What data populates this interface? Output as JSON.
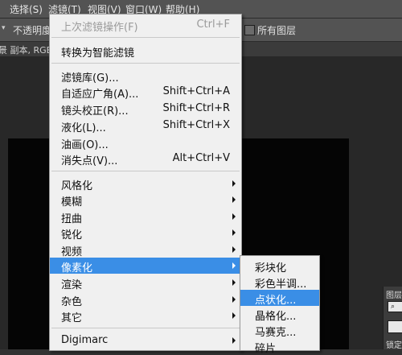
{
  "menubar": {
    "items": [
      {
        "label": "选择(S)"
      },
      {
        "label": "滤镜(T)"
      },
      {
        "label": "视图(V)"
      },
      {
        "label": "窗口(W)"
      },
      {
        "label": "帮助(H)"
      }
    ]
  },
  "options": {
    "opacity_label": "不透明度",
    "all_layers_label": "所有图层"
  },
  "doc_tab": {
    "title": "景 副本, RGB"
  },
  "filter_menu": {
    "last_filter": {
      "label": "上次滤镜操作(F)",
      "shortcut": "Ctrl+F"
    },
    "convert_smart": {
      "label": "转换为智能滤镜"
    },
    "gallery": {
      "label": "滤镜库(G)..."
    },
    "adaptive_wide": {
      "label": "自适应广角(A)...",
      "shortcut": "Shift+Ctrl+A"
    },
    "lens_correction": {
      "label": "镜头校正(R)...",
      "shortcut": "Shift+Ctrl+R"
    },
    "liquify": {
      "label": "液化(L)...",
      "shortcut": "Shift+Ctrl+X"
    },
    "oil_paint": {
      "label": "油画(O)..."
    },
    "vanishing_point": {
      "label": "消失点(V)...",
      "shortcut": "Alt+Ctrl+V"
    },
    "stylize": {
      "label": "风格化"
    },
    "blur": {
      "label": "模糊"
    },
    "distort": {
      "label": "扭曲"
    },
    "sharpen": {
      "label": "锐化"
    },
    "video": {
      "label": "视频"
    },
    "pixelate": {
      "label": "像素化"
    },
    "render": {
      "label": "渲染"
    },
    "noise": {
      "label": "杂色"
    },
    "other": {
      "label": "其它"
    },
    "digimarc": {
      "label": "Digimarc"
    }
  },
  "pixelate_submenu": {
    "items": [
      {
        "label": "彩块化"
      },
      {
        "label": "彩色半调..."
      },
      {
        "label": "点状化..."
      },
      {
        "label": "晶格化..."
      },
      {
        "label": "马赛克..."
      },
      {
        "label": "碎片"
      }
    ],
    "highlighted_index": 2
  },
  "right_panel": {
    "tab_label": "图层",
    "lock_label": "锁定"
  },
  "colors": {
    "menubar_bg": "#535353",
    "menu_bg": "#f0f0f0",
    "highlight": "#3a8ee6"
  }
}
